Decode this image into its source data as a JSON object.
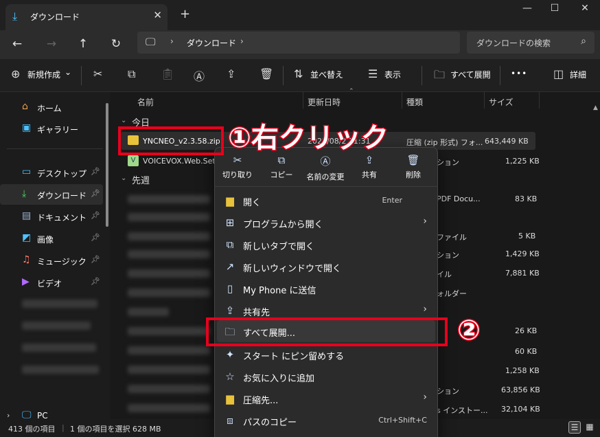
{
  "window": {
    "tab_title": "ダウンロード",
    "tab_close": "✕",
    "new_tab": "+",
    "minimize": "—",
    "maximize": "☐",
    "close": "✕"
  },
  "nav": {
    "back": "←",
    "forward": "→",
    "up": "↑",
    "refresh": "↻"
  },
  "address": {
    "root_icon": "monitor-icon",
    "sep1": "›",
    "path": "ダウンロード",
    "sep2": "›"
  },
  "search": {
    "placeholder": "ダウンロードの検索"
  },
  "toolbar": {
    "new": "新規作成",
    "new_chevron": "⌄",
    "sort": "並べ替え",
    "view": "表示",
    "extract_all": "すべて展開",
    "more": "•••",
    "details": "詳細"
  },
  "sidebar": {
    "items": [
      {
        "label": "ホーム",
        "icon": "home-icon"
      },
      {
        "label": "ギャラリー",
        "icon": "gallery-icon"
      },
      {
        "label": "デスクトップ",
        "icon": "desktop-icon"
      },
      {
        "label": "ダウンロード",
        "icon": "download-icon"
      },
      {
        "label": "ドキュメント",
        "icon": "document-icon"
      },
      {
        "label": "画像",
        "icon": "pictures-icon"
      },
      {
        "label": "ミュージック",
        "icon": "music-icon"
      },
      {
        "label": "ビデオ",
        "icon": "video-icon"
      },
      {
        "label": "PC",
        "icon": "pc-icon"
      }
    ]
  },
  "columns": {
    "name": "名前",
    "date": "更新日時",
    "type": "種類",
    "size": "サイズ"
  },
  "groups": {
    "today": "今日",
    "last_week": "先週"
  },
  "files": [
    {
      "name": "YNCNEO_v2.3.58.zip",
      "date": "2025/08/2 11:31",
      "type": "圧縮 (zip 形式) フォ...",
      "size": "643,449 KB"
    },
    {
      "name": "VOICEVOX.Web.Setu",
      "type": "ション",
      "size": "1,225 KB"
    }
  ],
  "blurred_rows": [
    {
      "type": "PDF Docu...",
      "size": "83 KB"
    },
    {
      "type": "ファイル",
      "size": "5 KB"
    },
    {
      "type": "ション",
      "size": "1,429 KB"
    },
    {
      "type": "イル",
      "size": "7,881 KB"
    },
    {
      "type": "ォルダー",
      "size": ""
    },
    {
      "type": "",
      "size": "26 KB"
    },
    {
      "type": "",
      "size": "60 KB"
    },
    {
      "type": "",
      "size": "1,258 KB"
    },
    {
      "type": "ション",
      "size": "63,856 KB"
    },
    {
      "type": "s インストー...",
      "size": "32,104 KB"
    }
  ],
  "context_menu": {
    "quick": [
      {
        "label": "切り取り",
        "icon": "scissors-icon"
      },
      {
        "label": "コピー",
        "icon": "copy-icon"
      },
      {
        "label": "名前の変更",
        "icon": "rename-icon"
      },
      {
        "label": "共有",
        "icon": "share-icon"
      },
      {
        "label": "削除",
        "icon": "trash-icon"
      }
    ],
    "items": [
      {
        "label": "開く",
        "shortcut": "Enter",
        "arrow": ""
      },
      {
        "label": "プログラムから開く",
        "shortcut": "",
        "arrow": "›"
      },
      {
        "label": "新しいタブで開く",
        "shortcut": "",
        "arrow": ""
      },
      {
        "label": "新しいウィンドウで開く",
        "shortcut": "",
        "arrow": ""
      },
      {
        "label": "My Phone に送信",
        "shortcut": "",
        "arrow": ""
      },
      {
        "label": "共有先",
        "shortcut": "",
        "arrow": "›"
      },
      {
        "label": "すべて展開...",
        "shortcut": "",
        "arrow": ""
      },
      {
        "label": "スタート にピン留めする",
        "shortcut": "",
        "arrow": ""
      },
      {
        "label": "お気に入りに追加",
        "shortcut": "",
        "arrow": ""
      },
      {
        "label": "圧縮先...",
        "shortcut": "",
        "arrow": "›"
      },
      {
        "label": "パスのコピー",
        "shortcut": "Ctrl+Shift+C",
        "arrow": ""
      }
    ]
  },
  "status": {
    "items": "413 個の項目",
    "selected": "1 個の項目を選択 628 MB"
  },
  "annotations": {
    "step1": "①右クリック",
    "step2": "②"
  },
  "colors": {
    "accent": "#4cc2ff",
    "annotation_red": "#e8001c",
    "zip_yellow": "#e8c23b"
  }
}
